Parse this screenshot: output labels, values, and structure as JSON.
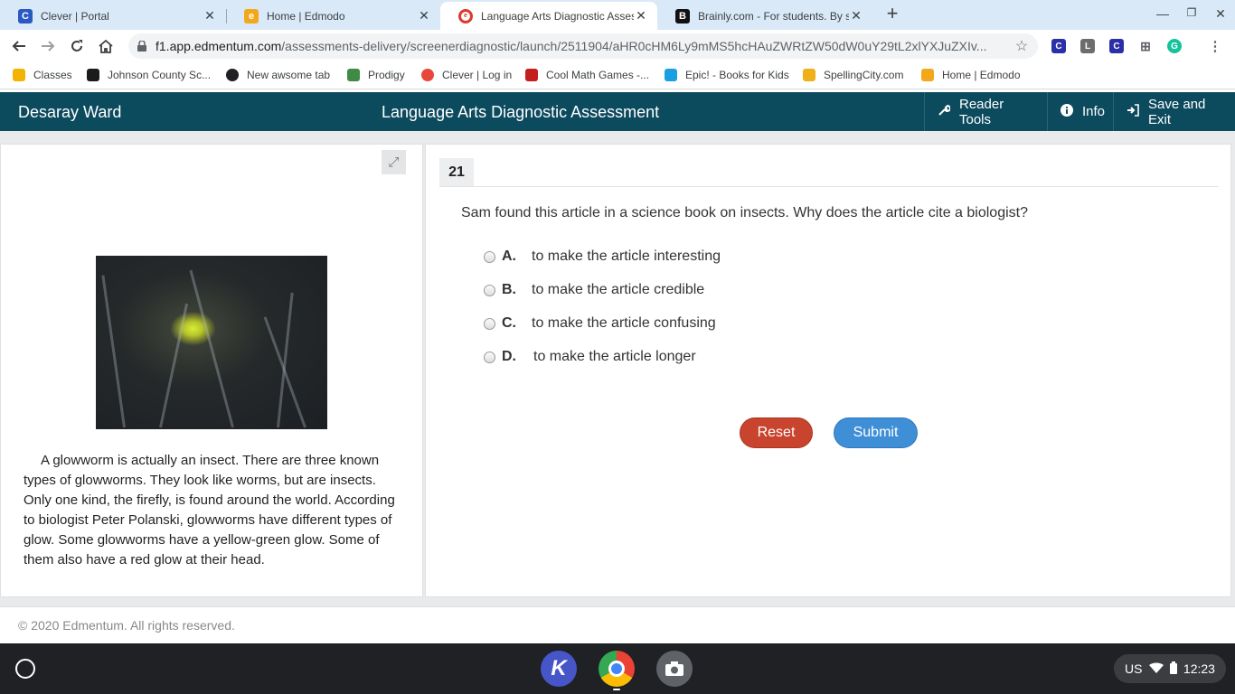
{
  "browser": {
    "tabs": [
      {
        "title": "Clever | Portal",
        "favicon": "C",
        "color": "#2b59c3",
        "active": false
      },
      {
        "title": "Home | Edmodo",
        "favicon": "e",
        "color": "#f3a81c",
        "active": false
      },
      {
        "title": "Language Arts Diagnostic Asses",
        "favicon": "e",
        "color": "#d93b2c",
        "active": true
      },
      {
        "title": "Brainly.com - For students. By st",
        "favicon": "B",
        "color": "#111111",
        "active": false
      }
    ],
    "url_host": "f1.app.edmentum.com",
    "url_path": "/assessments-delivery/screenerdiagnostic/launch/2511904/aHR0cHM6Ly9mMS5hcHAuZWRtZW50dW0uY29tL2xlYXJuZXIv...",
    "bookmarks": [
      {
        "label": "Classes",
        "color": "#f2b400"
      },
      {
        "label": "Johnson County Sc...",
        "color": "#1b1b1b"
      },
      {
        "label": "New awsome tab",
        "color": "#202124"
      },
      {
        "label": "Prodigy",
        "color": "#3f8b46"
      },
      {
        "label": "Clever | Log in",
        "color": "#e8483c"
      },
      {
        "label": "Cool Math Games -...",
        "color": "#c41e1e"
      },
      {
        "label": "Epic! - Books for Kids",
        "color": "#1aa0e0"
      },
      {
        "label": "SpellingCity.com",
        "color": "#f0b019"
      },
      {
        "label": "Home | Edmodo",
        "color": "#f3a81c"
      }
    ]
  },
  "app": {
    "user": "Desaray Ward",
    "title": "Language Arts Diagnostic Assessment",
    "reader_tools": "Reader Tools",
    "info": "Info",
    "save_exit": "Save and Exit"
  },
  "passage": "A glowworm is actually an insect. There are three known types of glowworms. They look like worms, but are insects. Only one kind, the firefly, is found around the world. According to biologist Peter Polanski, glowworms have different types of glow. Some glowworms have a yellow-green glow. Some of them also have a red glow at their head.",
  "question": {
    "number": "21",
    "text": "Sam found this article in a science book on insects. Why does the article cite a biologist?",
    "choices": [
      {
        "letter": "A.",
        "text": "to make the article interesting"
      },
      {
        "letter": "B.",
        "text": "to make the article credible"
      },
      {
        "letter": "C.",
        "text": "to make the article confusing"
      },
      {
        "letter": "D.",
        "text": "to make the article longer"
      }
    ],
    "reset_label": "Reset",
    "submit_label": "Submit"
  },
  "footer": "© 2020 Edmentum. All rights reserved.",
  "tray": {
    "locale": "US",
    "time": "12:23"
  },
  "colors": {
    "header_bg": "#0c4a5e",
    "reset": "#c8442e",
    "submit": "#3f8fd6"
  }
}
